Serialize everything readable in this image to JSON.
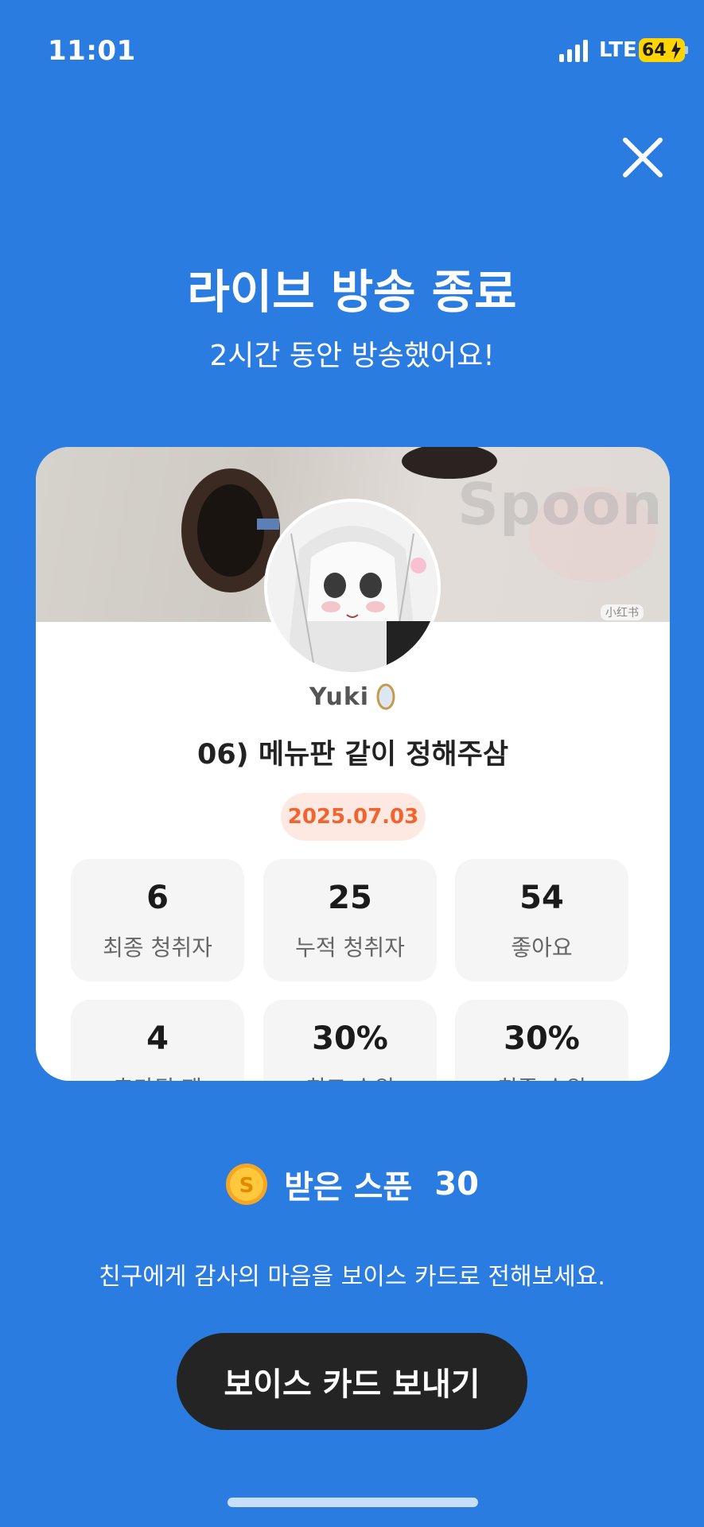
{
  "status_bar": {
    "time": "11:01",
    "network": "LTE",
    "battery": "64"
  },
  "header": {
    "title": "라이브 방송 종료",
    "subtitle": "2시간 동안 방송했어요!"
  },
  "card": {
    "banner_watermark": "Spoon",
    "banner_tag": "小红书",
    "username": "Yuki",
    "broadcast_title": "06) 메뉴판 같이 정해주삼",
    "date": "2025.07.03",
    "stats": [
      {
        "value": "6",
        "label": "최종 청취자"
      },
      {
        "value": "25",
        "label": "누적 청취자"
      },
      {
        "value": "54",
        "label": "좋아요"
      },
      {
        "value": "4",
        "label": "추가된 팬"
      },
      {
        "value": "30%",
        "label": "최고 순위"
      },
      {
        "value": "30%",
        "label": "최종 순위"
      }
    ]
  },
  "spoons": {
    "label": "받은 스푼",
    "count": "30"
  },
  "message": "친구에게 감사의 마음을 보이스 카드로 전해보세요.",
  "cta": {
    "label": "보이스 카드 보내기"
  },
  "colors": {
    "background": "#2a7ce0",
    "date_accent": "#f2642e",
    "button": "#242424"
  }
}
